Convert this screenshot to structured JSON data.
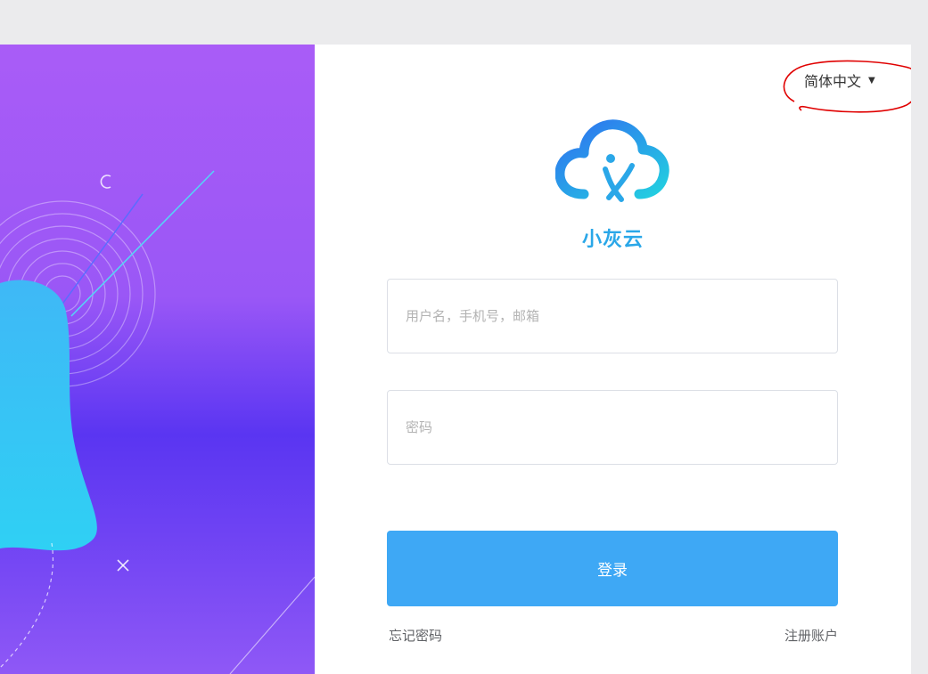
{
  "language": {
    "label": "简体中文",
    "caret": "▼"
  },
  "brand": {
    "name": "小灰云"
  },
  "form": {
    "username_placeholder": "用户名，手机号，邮箱",
    "password_placeholder": "密码",
    "login_label": "登录"
  },
  "links": {
    "forgot": "忘记密码",
    "register": "注册账户"
  },
  "colors": {
    "accent": "#3ea8f5",
    "annotation": "#e00000",
    "hero_top": "#a95cf7",
    "hero_mid": "#5a35f2"
  },
  "icons": {
    "logo": "cloud-logo-icon",
    "caret": "caret-down-icon",
    "decor_x": "cross-icon",
    "decor_c": "circle-icon"
  }
}
